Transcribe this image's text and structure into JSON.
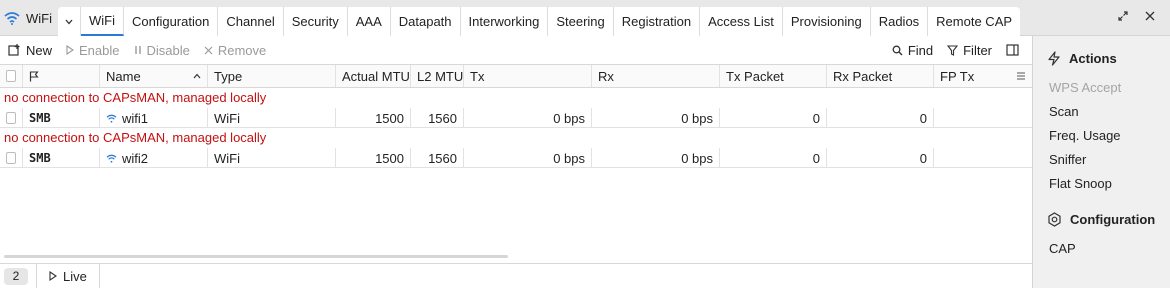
{
  "window": {
    "title": "WiFi",
    "tabs": [
      "WiFi",
      "Configuration",
      "Channel",
      "Security",
      "AAA",
      "Datapath",
      "Interworking",
      "Steering",
      "Registration",
      "Access List",
      "Provisioning",
      "Radios",
      "Remote CAP"
    ],
    "active_tab": "WiFi"
  },
  "toolbar": {
    "new": "New",
    "enable": "Enable",
    "disable": "Disable",
    "remove": "Remove",
    "find": "Find",
    "filter": "Filter"
  },
  "table": {
    "columns": {
      "name": "Name",
      "type": "Type",
      "actual_mtu": "Actual MTU",
      "l2_mtu": "L2 MTU",
      "tx": "Tx",
      "rx": "Rx",
      "tx_packet": "Tx Packet",
      "rx_packet": "Rx Packet",
      "fp_tx": "FP Tx"
    },
    "rows": [
      {
        "message": "no connection to CAPsMAN, managed locally",
        "flags": "SMB",
        "name": "wifi1",
        "type": "WiFi",
        "actual_mtu": "1500",
        "l2_mtu": "1560",
        "tx": "0 bps",
        "rx": "0 bps",
        "tx_packet": "0",
        "rx_packet": "0",
        "fp_tx": ""
      },
      {
        "message": "no connection to CAPsMAN, managed locally",
        "flags": "SMB",
        "name": "wifi2",
        "type": "WiFi",
        "actual_mtu": "1500",
        "l2_mtu": "1560",
        "tx": "0 bps",
        "rx": "0 bps",
        "tx_packet": "0",
        "rx_packet": "0",
        "fp_tx": ""
      }
    ]
  },
  "status": {
    "count": "2",
    "live": "Live"
  },
  "sidebar": {
    "actions_title": "Actions",
    "actions": [
      "WPS Accept",
      "Scan",
      "Freq. Usage",
      "Sniffer",
      "Flat Snoop"
    ],
    "config_title": "Configuration",
    "config_items": [
      "CAP"
    ]
  },
  "colors": {
    "accent": "#2b7bd6",
    "error_text": "#c41010",
    "disabled_text": "#9a9a9a"
  }
}
